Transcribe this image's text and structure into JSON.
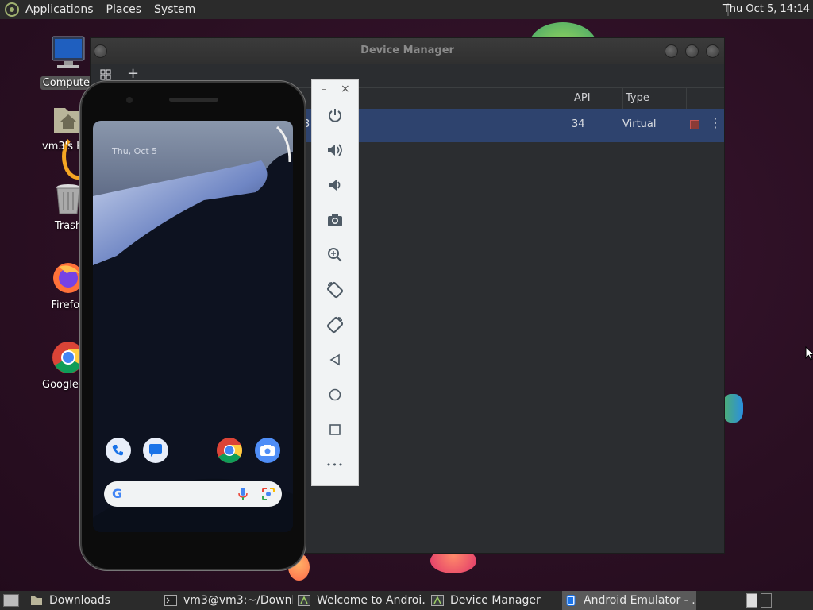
{
  "top_panel": {
    "menus": [
      "Applications",
      "Places",
      "System"
    ],
    "clock": "Thu Oct  5, 14:14"
  },
  "desktop_icons": [
    {
      "label": "Computer",
      "icon": "computer-icon"
    },
    {
      "label": "vm3's Home",
      "icon": "home-folder-icon"
    },
    {
      "label": "Trash",
      "icon": "trash-icon"
    },
    {
      "label": "Firefox",
      "icon": "firefox-icon"
    },
    {
      "label": "Google Chrome",
      "icon": "chrome-icon"
    }
  ],
  "device_manager": {
    "title": "Device Manager",
    "toolbar": {
      "grid_icon": "grid-icon",
      "add_icon": "plus-icon",
      "add_label": "+"
    },
    "columns": [
      "API",
      "Type"
    ],
    "rows": [
      {
        "api": "34",
        "type": "Virtual",
        "status_color": "#c75450"
      }
    ],
    "row_name_fragment": "3"
  },
  "emulator": {
    "lock_date": "Thu, Oct 5",
    "controls": [
      "power",
      "volume-up",
      "volume-down",
      "camera",
      "zoom",
      "rotate-left",
      "rotate-right",
      "back",
      "home",
      "overview",
      "more"
    ],
    "window_buttons": {
      "minimize": "–",
      "close": "×"
    },
    "more_label": "•••",
    "dock_apps": [
      "phone",
      "messages",
      "chrome",
      "camera"
    ],
    "search_bar": {
      "logo": "G"
    }
  },
  "taskbar": {
    "items": [
      {
        "label": "Downloads",
        "icon": "folder-icon"
      },
      {
        "label": "vm3@vm3:~/Downl…",
        "icon": "terminal-icon"
      },
      {
        "label": "Welcome to Androi…",
        "icon": "android-studio-icon"
      },
      {
        "label": "Device Manager",
        "icon": "android-studio-icon"
      },
      {
        "label": "Android Emulator - …",
        "icon": "emulator-icon"
      }
    ]
  },
  "colors": {
    "desktop_bg": "#2a0f22",
    "panel_bg": "#2b2b2b",
    "selection": "#2e436e",
    "accent_blue": "#1a73e8"
  }
}
